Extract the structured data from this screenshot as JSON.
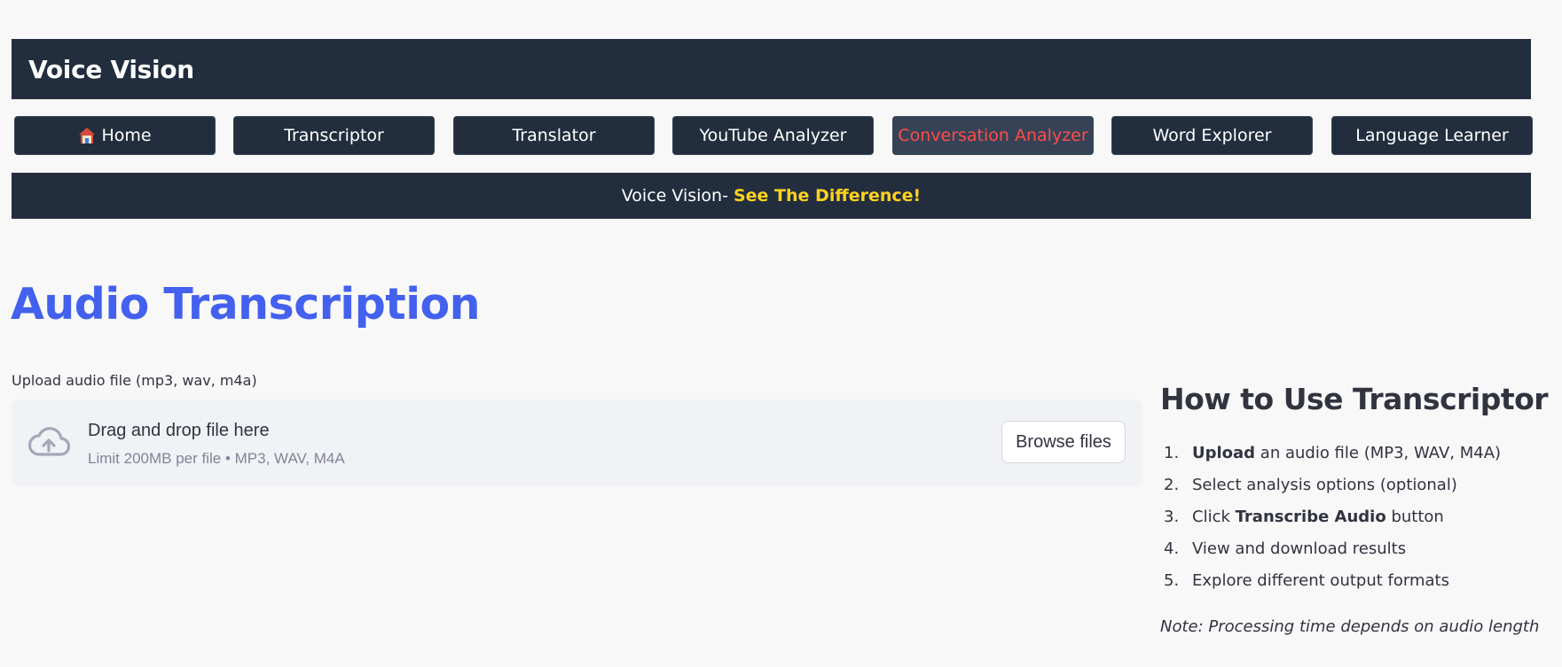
{
  "app": {
    "title": "Voice Vision"
  },
  "nav": {
    "items": [
      {
        "label": "Home",
        "icon": "house-icon"
      },
      {
        "label": "Transcriptor"
      },
      {
        "label": "Translator"
      },
      {
        "label": "YouTube Analyzer"
      },
      {
        "label": "Conversation Analyzer",
        "active": true
      },
      {
        "label": "Word Explorer"
      },
      {
        "label": "Language Learner"
      }
    ]
  },
  "banner": {
    "prefix": "Voice Vision- ",
    "highlight": "See The Difference!"
  },
  "page": {
    "title": "Audio Transcription"
  },
  "upload": {
    "label": "Upload audio file (mp3, wav, m4a)",
    "drop_text": "Drag and drop file here",
    "limit_text": "Limit 200MB per file • MP3, WAV, M4A",
    "browse_label": "Browse files",
    "icon": "cloud-upload-icon"
  },
  "help": {
    "title": "How to Use Transcriptor",
    "steps": [
      {
        "num": "1.",
        "strong": "Upload",
        "after": " an audio file (MP3, WAV, M4A)"
      },
      {
        "num": "2.",
        "text": "Select analysis options (optional)"
      },
      {
        "num": "3.",
        "before": "Click ",
        "strong": "Transcribe Audio",
        "after": " button"
      },
      {
        "num": "4.",
        "text": "View and download results"
      },
      {
        "num": "5.",
        "text": "Explore different output formats"
      }
    ],
    "note": "Note: Processing time depends on audio length"
  },
  "colors": {
    "header_bg": "#222e3e",
    "active_nav_bg": "#364356",
    "active_nav_text": "#ff4b4b",
    "accent_title": "#4361ee",
    "banner_highlight": "#ffd21f",
    "dropzone_bg": "#f0f2f6"
  }
}
